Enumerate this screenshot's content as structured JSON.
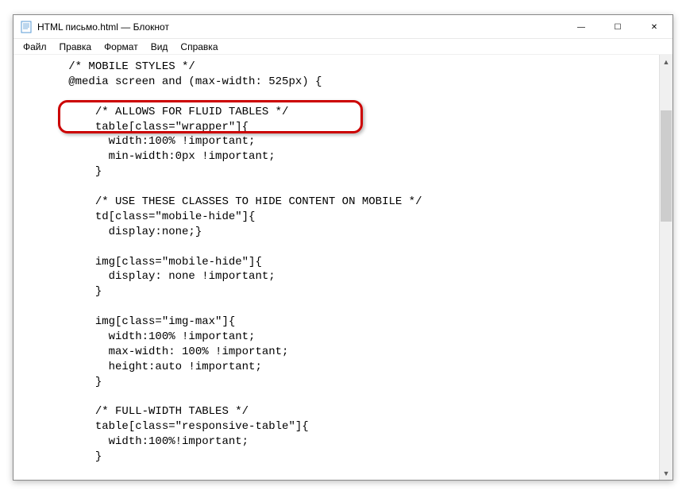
{
  "window": {
    "title": "HTML письмо.html — Блокнот"
  },
  "controls": {
    "minimize": "—",
    "maximize": "☐",
    "close": "✕"
  },
  "menu": {
    "file": "Файл",
    "edit": "Правка",
    "format": "Формат",
    "view": "Вид",
    "help": "Справка"
  },
  "code": {
    "lines": [
      "        /* MOBILE STYLES */",
      "        @media screen and (max-width: 525px) {",
      "",
      "            /* ALLOWS FOR FLUID TABLES */",
      "            table[class=\"wrapper\"]{",
      "              width:100% !important;",
      "              min-width:0px !important;",
      "            }",
      "",
      "            /* USE THESE CLASSES TO HIDE CONTENT ON MOBILE */",
      "            td[class=\"mobile-hide\"]{",
      "              display:none;}",
      "",
      "            img[class=\"mobile-hide\"]{",
      "              display: none !important;",
      "            }",
      "",
      "            img[class=\"img-max\"]{",
      "              width:100% !important;",
      "              max-width: 100% !important;",
      "              height:auto !important;",
      "            }",
      "",
      "            /* FULL-WIDTH TABLES */",
      "            table[class=\"responsive-table\"]{",
      "              width:100%!important;",
      "            }"
    ]
  },
  "scroll": {
    "up": "▲",
    "down": "▼"
  }
}
